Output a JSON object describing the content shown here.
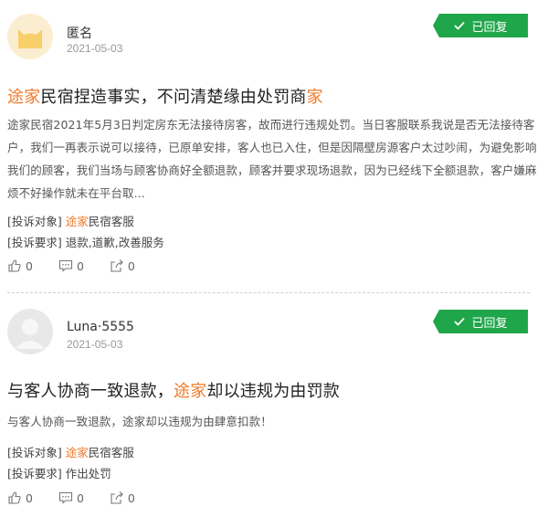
{
  "comments": [
    {
      "author": "匿名",
      "date": "2021-05-03",
      "status": "已回复",
      "title_pre": "",
      "title_hl1": "途家",
      "title_mid": "民宿捏造事实，不问清楚缘由处罚商",
      "title_hl2": "家",
      "content": "途家民宿2021年5月3日判定房东无法接待房客，故而进行违规处罚。当日客服联系我说是否无法接待客户，我们一再表示说可以接待，已原单安排，客人也已入住，但是因隔壁房源客户太过吵闹，为避免影响我们的顾客，我们当场与顾客协商好全额退款，顾客并要求现场退款，因为已经线下全额退款，客户嫌麻烦不好操作就未在平台取...",
      "target_label": "[投诉对象]",
      "target_hl": "途家",
      "target_rest": "民宿客服",
      "demand_label": "[投诉要求]",
      "demand_value": "退款,道歉,改善服务",
      "likes": "0",
      "comments": "0",
      "shares": "0"
    },
    {
      "author": "Luna·5555",
      "date": "2021-05-03",
      "status": "已回复",
      "title_pre": "与客人协商一致退款，",
      "title_hl1": "途家",
      "title_mid": "却以违规为由罚款",
      "title_hl2": "",
      "content": "与客人协商一致退款，途家却以违规为由肆意扣款！",
      "target_label": "[投诉对象]",
      "target_hl": "途家",
      "target_rest": "民宿客服",
      "demand_label": "[投诉要求]",
      "demand_value": "作出处罚",
      "likes": "0",
      "comments": "0",
      "shares": "0"
    }
  ],
  "colors": {
    "accent": "#ee7a2a",
    "badge": "#1fa64a",
    "muted": "#999999"
  }
}
